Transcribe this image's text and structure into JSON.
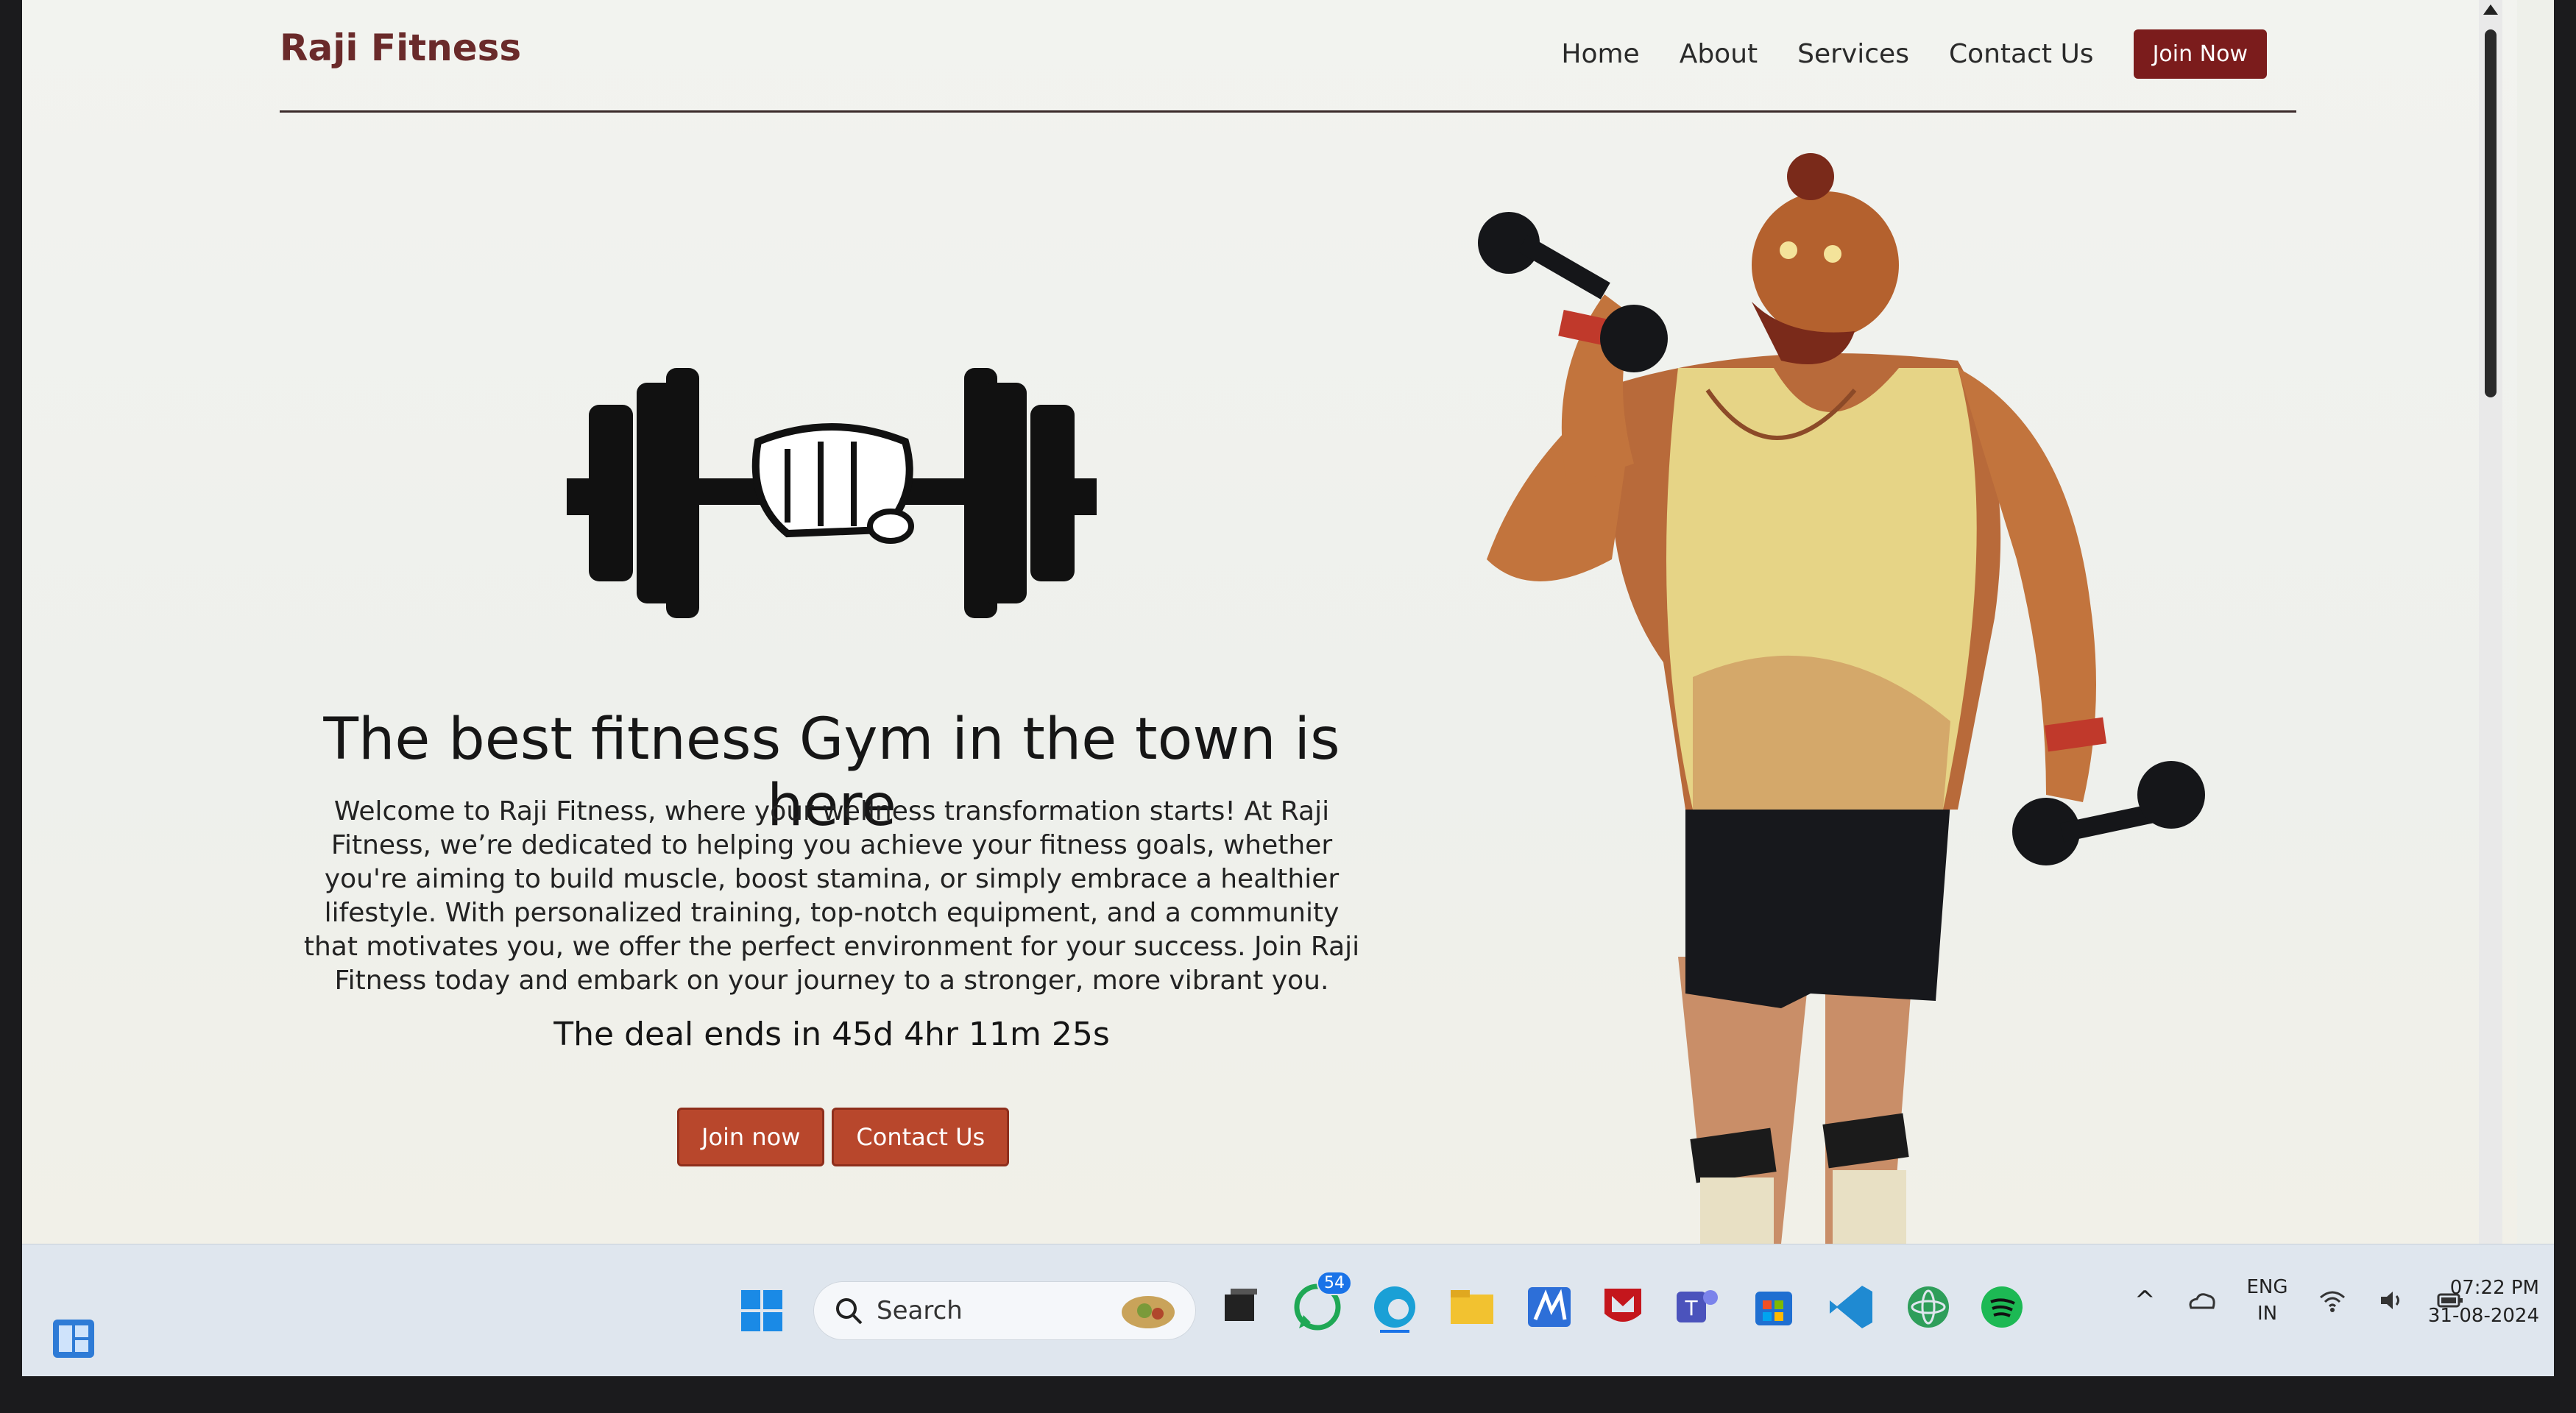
{
  "navbar": {
    "brand": "Raji Fitness",
    "links": [
      "Home",
      "About",
      "Services",
      "Contact Us"
    ],
    "join_label": "Join Now"
  },
  "hero": {
    "title": "The best fitness Gym in the town is here",
    "description": "Welcome to Raji Fitness, where your wellness transformation starts! At Raji Fitness, we’re dedicated to helping you achieve your fitness goals, whether you're aiming to build muscle, boost stamina, or simply embrace a healthier lifestyle. With personalized training, top-notch equipment, and a community that motivates you, we offer the perfect environment for your success. Join Raji Fitness today and embark on your journey to a stronger, more vibrant you.",
    "deal": "The deal ends in 45d 4hr 11m 25s",
    "buttons": {
      "join": "Join now",
      "contact": "Contact Us"
    }
  },
  "taskbar": {
    "search_label": "Search",
    "whatsapp_badge": "54",
    "lang": {
      "top": "ENG",
      "bottom": "IN"
    },
    "time": "07:22 PM",
    "date": "31-08-2024"
  },
  "colors": {
    "brand": "#6a2a2a",
    "join_button": "#7b1c1c",
    "cta_button": "#b8472c"
  },
  "icons": [
    "widgets-icon",
    "windows-start-icon",
    "search-icon",
    "task-view-icon",
    "whatsapp-icon",
    "edge-icon",
    "file-explorer-icon",
    "mcafee-icon",
    "teams-icon",
    "store-icon",
    "vscode-icon",
    "atom-icon",
    "spotify-icon",
    "wifi-icon",
    "volume-icon",
    "battery-icon"
  ]
}
